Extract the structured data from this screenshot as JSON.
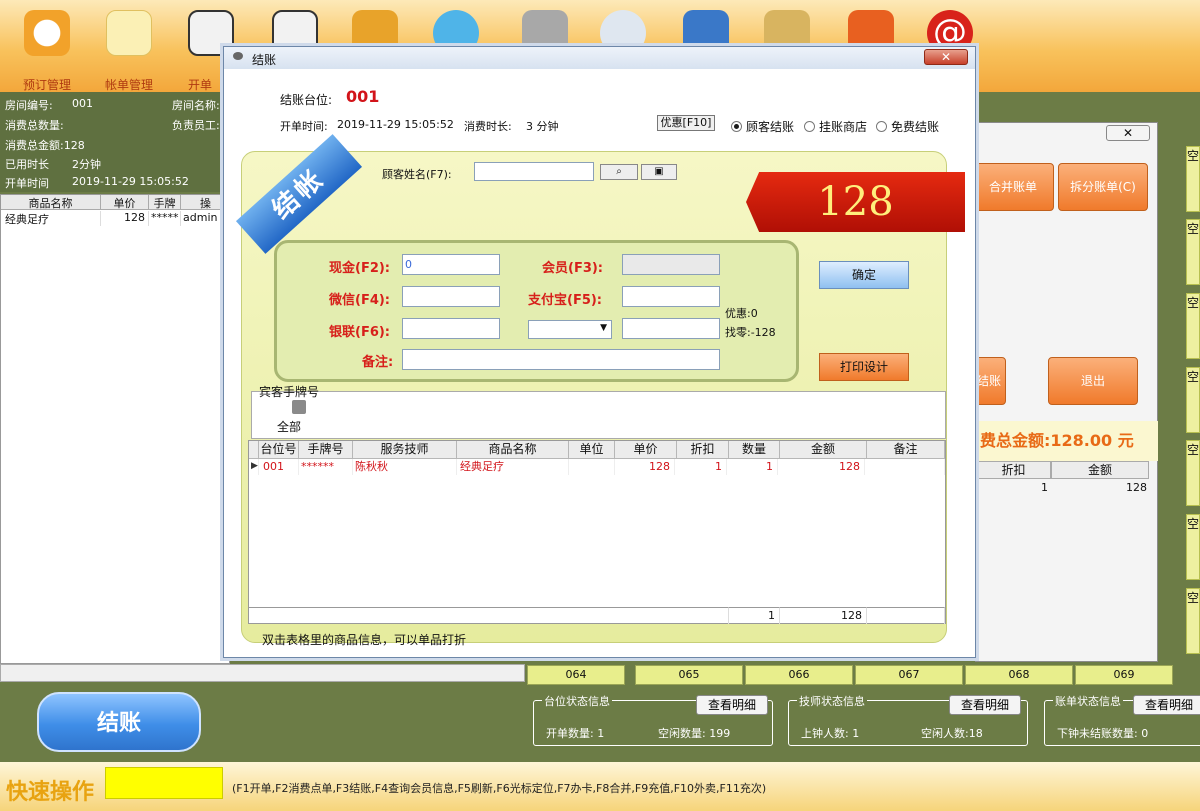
{
  "toolbar": {
    "items": [
      {
        "label": "预订管理",
        "icon": "clock-icon"
      },
      {
        "label": "帐单管理",
        "icon": "note-icon"
      },
      {
        "label": "开单",
        "icon": "clipboard-icon"
      },
      {
        "label": "",
        "icon": "clipboard2-icon"
      },
      {
        "label": "",
        "icon": "cart-icon"
      },
      {
        "label": "",
        "icon": "users-icon"
      },
      {
        "label": "",
        "icon": "calculator-icon"
      },
      {
        "label": "",
        "icon": "search-doc-icon"
      },
      {
        "label": "",
        "icon": "folder-icon"
      },
      {
        "label": "",
        "icon": "books-icon"
      },
      {
        "label": "",
        "icon": "finder-icon"
      },
      {
        "label": "",
        "icon": "at-icon"
      }
    ]
  },
  "left_info": {
    "room_no_label": "房间编号:",
    "room_no": "001",
    "room_name_label": "房间名称:",
    "total_qty_label": "消费总数量:",
    "staff_label": "负责员工:",
    "total_amount": "消费总金额:128",
    "used_time_label": "已用时长",
    "used_time": "2分钟",
    "open_time_label": "开单时间",
    "open_time": "2019-11-29 15:05:52"
  },
  "left_table": {
    "headers": [
      "商品名称",
      "单价",
      "手牌号",
      "操"
    ],
    "row": [
      "经典足疗",
      "128",
      "*****",
      "admin"
    ]
  },
  "dialog": {
    "title": "结账",
    "close": "✕",
    "table_label": "结账台位:",
    "table_value": "001",
    "open_time_label": "开单时间:",
    "open_time": "2019-11-29 15:05:52",
    "duration_label": "消费时长:",
    "duration": "3 分钟",
    "discount_btn": "优惠[F10]",
    "radio_customer": "顾客结账",
    "radio_hang": "挂账商店",
    "radio_free": "免费结账",
    "ribbon": "结帐",
    "customer_name_label": "顾客姓名(F7):",
    "amount": "128",
    "cash_label": "现金(F2):",
    "cash_value": "0",
    "member_label": "会员(F3):",
    "wechat_label": "微信(F4):",
    "alipay_label": "支付宝(F5):",
    "unionpay_label": "银联(F6):",
    "remark_label": "备注:",
    "discount_info": "优惠:0",
    "change_info": "找零:-128",
    "confirm_btn": "确定",
    "print_btn": "打印设计",
    "guest_card_label": "宾客手牌号",
    "guest_card_all": "全部",
    "grid_headers": [
      "台位号",
      "手牌号",
      "服务技师",
      "商品名称",
      "单位",
      "单价",
      "折扣",
      "数量",
      "金额",
      "备注"
    ],
    "grid_row": {
      "table": "001",
      "card": "******",
      "tech": "陈秋秋",
      "item": "经典足疗",
      "unit": "",
      "price": "128",
      "discount": "1",
      "qty": "1",
      "amount": "128",
      "remark": ""
    },
    "grid_footer": {
      "qty": "1",
      "amount": "128"
    },
    "hint": "双击表格里的商品信息，可以单品打折"
  },
  "right_window": {
    "close": "✕",
    "merge_btn": "合并账单",
    "split_btn": "拆分账单(C)",
    "checkout_btn_partial": "结账",
    "exit_btn": "退出",
    "total_label": "费总金额:128.00 元",
    "col_discount": "折扣",
    "col_amount": "金额",
    "row_discount": "1",
    "row_amount": "128",
    "tile_char": "空"
  },
  "bottom": {
    "table_cells": [
      "064",
      "065",
      "066",
      "067",
      "068",
      "069"
    ],
    "big_checkout": "结账",
    "status_table": {
      "title": "台位状态信息",
      "btn": "查看明细",
      "open_count": "开单数量: 1",
      "free_count": "空闲数量: 199"
    },
    "status_tech": {
      "title": "技师状态信息",
      "btn": "查看明细",
      "on_clock": "上钟人数: 1",
      "idle": "空闲人数:18"
    },
    "status_bill": {
      "title": "账单状态信息",
      "btn": "查看明细",
      "unsettled": "下钟未结账数量: 0"
    },
    "quick_label": "快速操作",
    "quick_hint": "(F1开单,F2消费点单,F3结账,F4查询会员信息,F5刷新,F6光标定位,F7办卡,F8合并,F9充值,F10外卖,F11充次)"
  }
}
